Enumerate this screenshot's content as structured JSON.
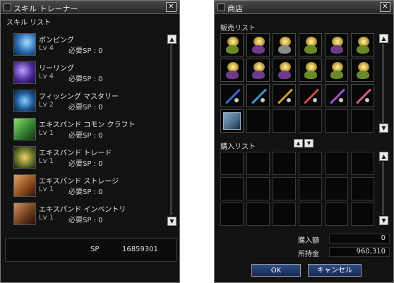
{
  "trainer": {
    "title": "スキル トレーナー",
    "close": "✕",
    "list_label": "スキル リスト",
    "skills": [
      {
        "name": "ポンピング",
        "level": "Lv 4",
        "sp": "必要SP : 0",
        "icon": "pumping-icon"
      },
      {
        "name": "リーリング",
        "level": "Lv 4",
        "sp": "必要SP : 0",
        "icon": "reeling-icon"
      },
      {
        "name": "フィッシング マスタリー",
        "level": "Lv 2",
        "sp": "必要SP : 0",
        "icon": "fishing-mastery-icon"
      },
      {
        "name": "エキスパンド コモン クラフト",
        "level": "Lv 1",
        "sp": "必要SP : 0",
        "icon": "common-craft-icon"
      },
      {
        "name": "エキスパンド トレード",
        "level": "Lv 1",
        "sp": "必要SP : 0",
        "icon": "trade-icon"
      },
      {
        "name": "エキスパンド ストレージ",
        "level": "Lv 1",
        "sp": "必要SP : 0",
        "icon": "storage-icon"
      },
      {
        "name": "エキスパンド インベントリ",
        "level": "Lv 1",
        "sp": "必要SP : 0",
        "icon": "inventory-icon"
      }
    ],
    "sp_label": "SP",
    "sp_value": "16859301",
    "scroll_up": "▲",
    "scroll_down": "▼"
  },
  "shop": {
    "title": "商店",
    "close": "✕",
    "sell_label": "販売リスト",
    "buy_label": "購入リスト",
    "sell_items": [
      {
        "type": "lure",
        "color": "#6a8a2a",
        "icon": "green-lure-icon"
      },
      {
        "type": "lure",
        "color": "#6f3a8a",
        "icon": "purple-lure-icon"
      },
      {
        "type": "lure",
        "color": "#8a8a8a",
        "icon": "white-lure-icon"
      },
      {
        "type": "lure",
        "color": "#6a8a2a",
        "icon": "green-lure-icon"
      },
      {
        "type": "lure",
        "color": "#6f3a8a",
        "icon": "purple-lure-icon"
      },
      {
        "type": "lure",
        "color": "#6a8a2a",
        "icon": "green-lure-icon"
      },
      {
        "type": "lure",
        "color": "#6f3a8a",
        "icon": "purple-lure-icon"
      },
      {
        "type": "lure",
        "color": "#6f3a8a",
        "icon": "purple-lure-icon"
      },
      {
        "type": "lure",
        "color": "#6f3a8a",
        "icon": "purple-lure-icon"
      },
      {
        "type": "lure",
        "color": "#6a8a2a",
        "icon": "green-lure-icon"
      },
      {
        "type": "lure",
        "color": "#6a8a2a",
        "icon": "green-lure-icon"
      },
      {
        "type": "lure",
        "color": "#6a8a2a",
        "icon": "green-lure-icon"
      },
      {
        "type": "pole",
        "color": "#3a6ad0",
        "icon": "blue-rod-icon"
      },
      {
        "type": "pole",
        "color": "#3a9ad0",
        "icon": "cyan-rod-icon"
      },
      {
        "type": "pole",
        "color": "#d0a030",
        "icon": "gold-rod-icon"
      },
      {
        "type": "pole",
        "color": "#d05040",
        "icon": "red-rod-icon"
      },
      {
        "type": "pole",
        "color": "#a050d0",
        "icon": "violet-rod-icon"
      },
      {
        "type": "pole",
        "color": "#d06080",
        "icon": "pink-rod-icon"
      },
      {
        "type": "book",
        "color": "#4a6a8a",
        "icon": "book-icon"
      }
    ],
    "scroll_up": "▲",
    "scroll_down": "▼",
    "sort_up": "▲",
    "sort_down": "▼",
    "purchase_label": "購入額",
    "purchase_value": "0",
    "money_label": "所持金",
    "money_value": "960,310",
    "ok": "OK",
    "cancel": "キャンセル"
  }
}
